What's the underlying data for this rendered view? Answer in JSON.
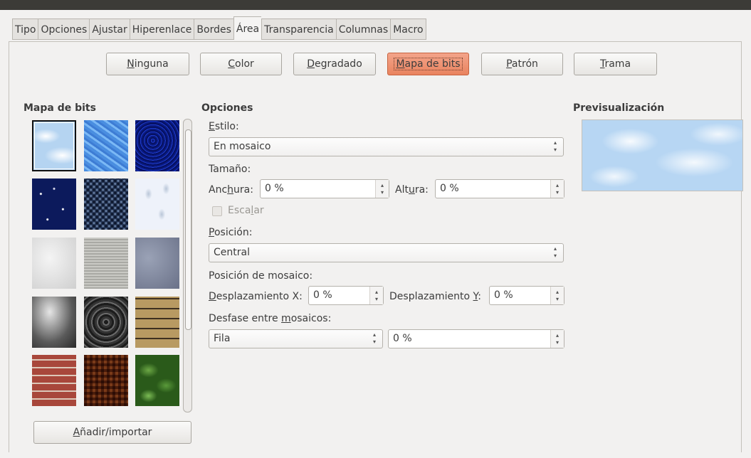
{
  "tabs": [
    "Tipo",
    "Opciones",
    "Ajustar",
    "Hiperenlace",
    "Bordes",
    "Área",
    "Transparencia",
    "Columnas",
    "Macro"
  ],
  "active_tab": "Área",
  "fill_buttons": {
    "ninguna": {
      "pre": "",
      "u": "N",
      "post": "inguna"
    },
    "color": {
      "pre": "",
      "u": "C",
      "post": "olor"
    },
    "degradado": {
      "pre": "",
      "u": "D",
      "post": "egradado"
    },
    "mapa_de_bits": {
      "pre": "",
      "u": "M",
      "post": "apa de bits"
    },
    "patron": {
      "pre": "",
      "u": "P",
      "post": "atrón"
    },
    "trama": {
      "pre": "",
      "u": "T",
      "post": "rama"
    }
  },
  "active_fill": "Mapa de bits",
  "bitmap_section": {
    "heading": "Mapa de bits",
    "add_button": {
      "pre": "",
      "u": "A",
      "post": "ñadir/importar"
    }
  },
  "options": {
    "heading": "Opciones",
    "estilo": {
      "pre": "",
      "u": "E",
      "post": "stilo:",
      "value": "En mosaico"
    },
    "tamano_label": "Tamaño:",
    "anchura": {
      "pre": "Anc",
      "u": "h",
      "post": "ura:",
      "value": "0 %"
    },
    "altura": {
      "pre": "Alt",
      "u": "u",
      "post": "ra:",
      "value": "0 %"
    },
    "escalar": {
      "pre": "Esca",
      "u": "l",
      "post": "ar",
      "checked": false
    },
    "posicion": {
      "pre": "",
      "u": "P",
      "post": "osición:",
      "value": "Central"
    },
    "posicion_mosaico_label": "Posición de mosaico:",
    "desp_x": {
      "pre": "",
      "u": "D",
      "post": "esplazamiento X:",
      "value": "0 %"
    },
    "desp_y": {
      "pre": "Desplazamiento ",
      "u": "Y",
      "post": ":",
      "value": "0 %"
    },
    "desfase": {
      "pre": "Desfase entre ",
      "u": "m",
      "post": "osaicos:",
      "mode": "Fila",
      "value": "0 %"
    }
  },
  "preview": {
    "heading": "Previsualización"
  },
  "colors": {
    "topbar": "#3c3b37",
    "active_button": "#e9835f",
    "background": "#f2f1f0"
  }
}
